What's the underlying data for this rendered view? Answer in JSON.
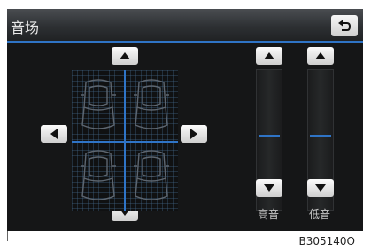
{
  "screen": {
    "title": "音场",
    "back_icon": "back-arrow-icon"
  },
  "balance": {
    "up_icon": "arrow-up-icon",
    "down_icon": "arrow-down-icon",
    "left_icon": "arrow-left-icon",
    "right_icon": "arrow-right-icon",
    "seats": [
      "front-left",
      "front-right",
      "rear-left",
      "rear-right"
    ]
  },
  "sliders": [
    {
      "label": "高音"
    },
    {
      "label": "低音"
    }
  ],
  "footer": {
    "code": "B305140O"
  },
  "colors": {
    "accent": "#2f74c6",
    "screen_bg": "#151617",
    "button": "#e8e8e8"
  }
}
